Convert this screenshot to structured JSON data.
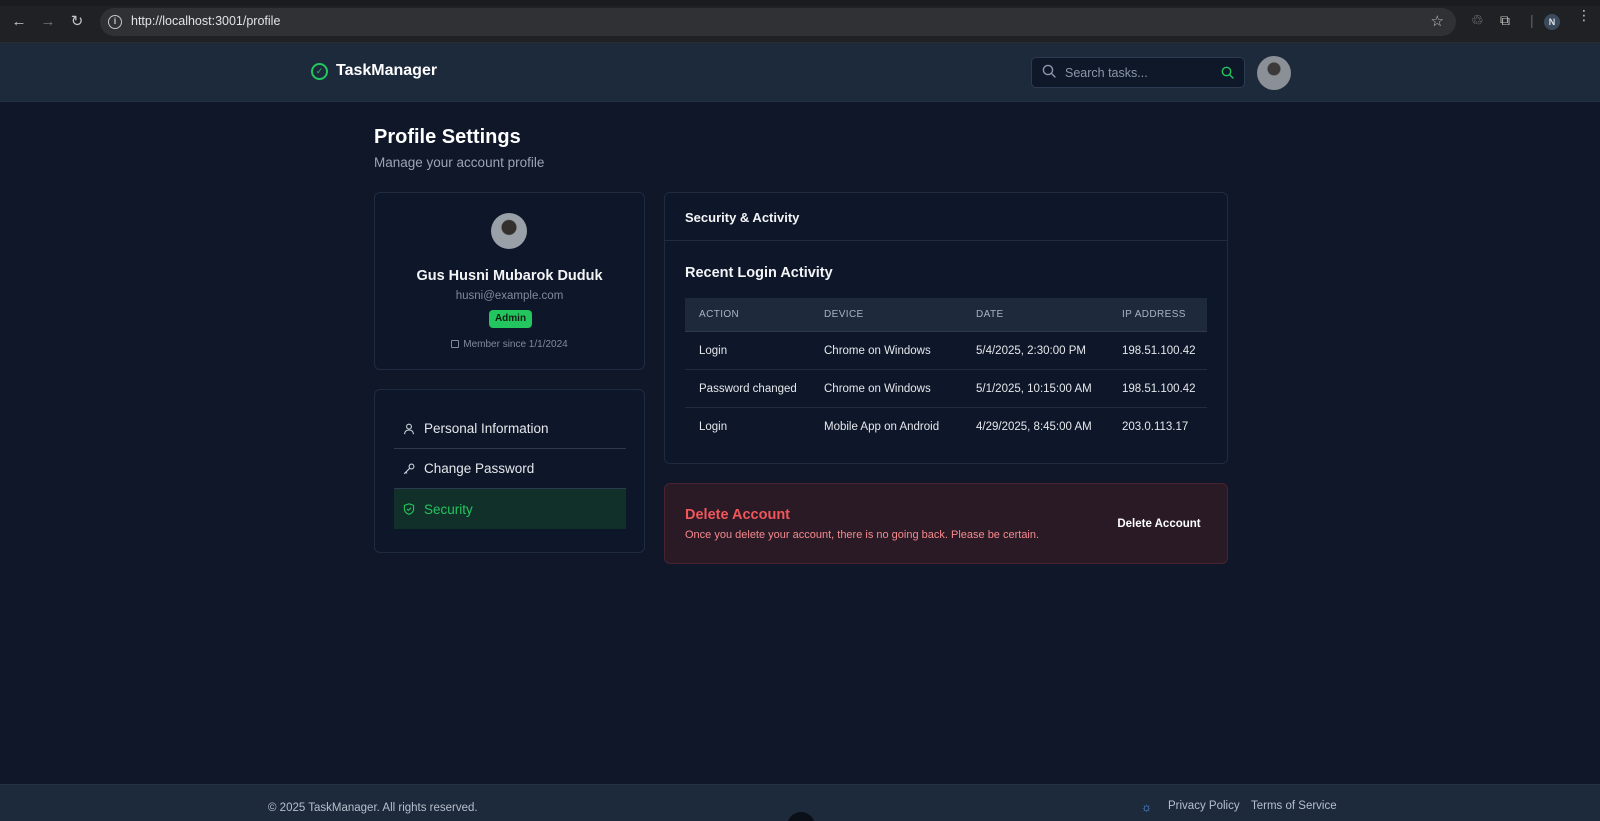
{
  "browser": {
    "url": "http://localhost:3001/profile",
    "profile_initial": "N"
  },
  "header": {
    "brand": "TaskManager",
    "search_placeholder": "Search tasks..."
  },
  "page": {
    "title": "Profile Settings",
    "subtitle": "Manage your account profile"
  },
  "profile": {
    "name": "Gus Husni Mubarok Duduk",
    "email": "husni@example.com",
    "role": "Admin",
    "member_since": "Member since 1/1/2024"
  },
  "nav": {
    "items": [
      {
        "label": "Personal Information",
        "icon": "user-icon"
      },
      {
        "label": "Change Password",
        "icon": "key-icon"
      },
      {
        "label": "Security",
        "icon": "shield-icon",
        "active": true
      }
    ]
  },
  "security": {
    "title": "Security & Activity",
    "subtitle": "Recent Login Activity",
    "columns": [
      "ACTION",
      "DEVICE",
      "DATE",
      "IP ADDRESS"
    ],
    "rows": [
      [
        "Login",
        "Chrome on Windows",
        "5/4/2025, 2:30:00 PM",
        "198.51.100.42"
      ],
      [
        "Password changed",
        "Chrome on Windows",
        "5/1/2025, 10:15:00 AM",
        "198.51.100.42"
      ],
      [
        "Login",
        "Mobile App on Android",
        "4/29/2025, 8:45:00 AM",
        "203.0.113.17"
      ]
    ]
  },
  "danger": {
    "title": "Delete Account",
    "description": "Once you delete your account, there is no going back. Please be certain.",
    "button": "Delete Account"
  },
  "footer": {
    "copyright": "© 2025 TaskManager. All rights reserved.",
    "privacy": "Privacy Policy",
    "terms": "Terms of Service"
  },
  "colors": {
    "accent": "#22c55e",
    "background": "#0f1729",
    "danger": "#f0565a"
  }
}
